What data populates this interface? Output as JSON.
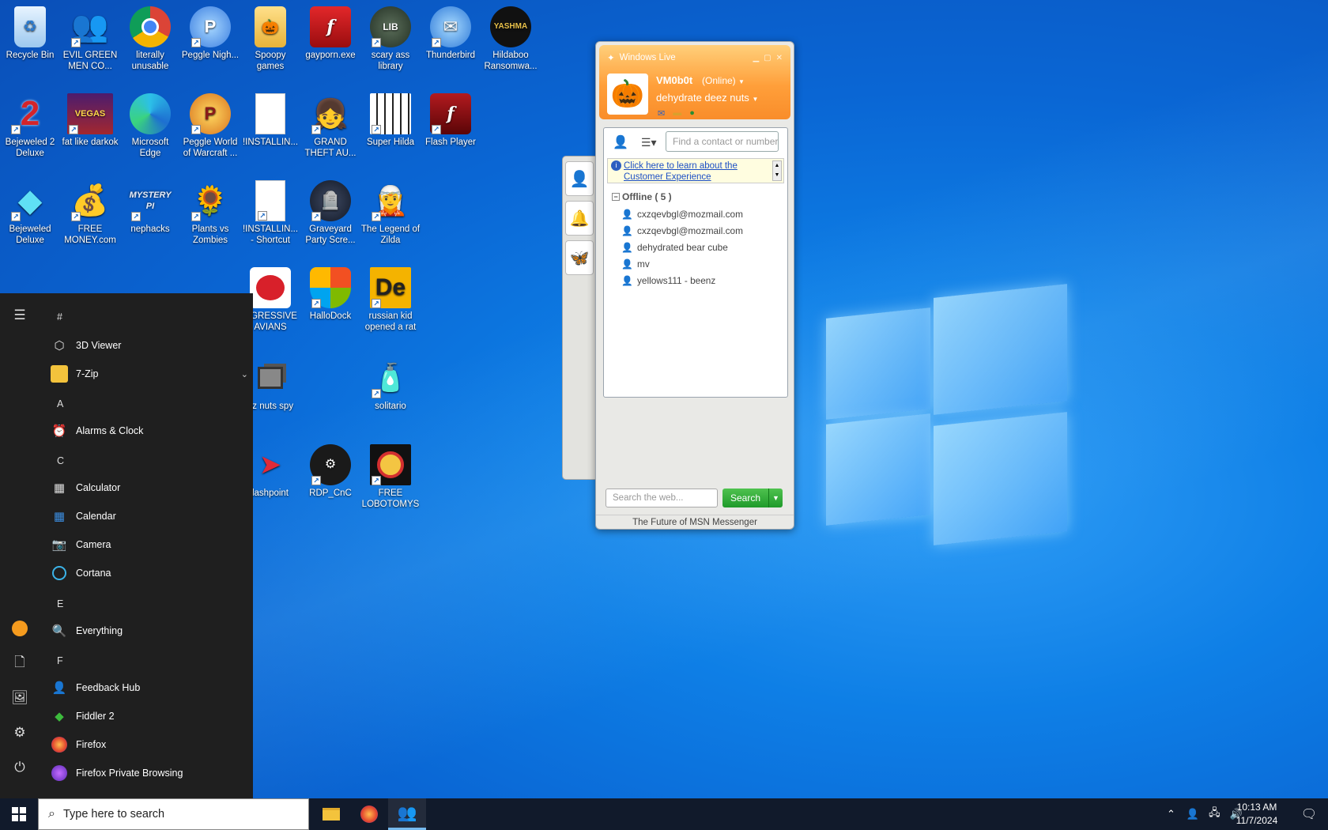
{
  "desktop": {
    "icons": [
      {
        "label": "Recycle Bin"
      },
      {
        "label": "EVIL GREEN MEN CO..."
      },
      {
        "label": "literally unusable"
      },
      {
        "label": "Peggle Nigh..."
      },
      {
        "label": "Spoopy games"
      },
      {
        "label": "gayporn.exe"
      },
      {
        "label": "scary ass library"
      },
      {
        "label": "Thunderbird"
      },
      {
        "label": "Hildaboo Ransomwa..."
      },
      {
        "label": "Bejeweled 2 Deluxe"
      },
      {
        "label": "fat like darkok"
      },
      {
        "label": "Microsoft Edge"
      },
      {
        "label": "Peggle World of Warcraft ..."
      },
      {
        "label": "!INSTALLIN..."
      },
      {
        "label": "GRAND THEFT AU..."
      },
      {
        "label": "Super Hilda"
      },
      {
        "label": "Flash Player"
      },
      {
        "label": "Bejeweled Deluxe"
      },
      {
        "label": "FREE MONEY.com"
      },
      {
        "label": "nephacks"
      },
      {
        "label": "Plants vs Zombies"
      },
      {
        "label": "!INSTALLIN... - Shortcut"
      },
      {
        "label": "Graveyard Party Scre..."
      },
      {
        "label": "The Legend of Zilda"
      },
      {
        "label": "GGRESSIVE AVIANS"
      },
      {
        "label": "HalloDock"
      },
      {
        "label": "russian kid opened a rat"
      },
      {
        "label": "ez nuts spy"
      },
      {
        "label": "solitario"
      },
      {
        "label": "lashpoint"
      },
      {
        "label": "RDP_CnC"
      },
      {
        "label": "FREE LOBOTOMYS"
      }
    ],
    "logo_texts": {
      "yashma": "YASHMA",
      "mystery": "MYSTERY PI",
      "vegas": "VEGAS",
      "de": "De"
    }
  },
  "start_menu": {
    "headers": {
      "hash": "#",
      "a": "A",
      "c": "C",
      "e": "E",
      "f": "F"
    },
    "apps": {
      "viewer3d": "3D Viewer",
      "zip7": "7-Zip",
      "alarms": "Alarms & Clock",
      "calculator": "Calculator",
      "calendar": "Calendar",
      "camera": "Camera",
      "cortana": "Cortana",
      "everything": "Everything",
      "feedback": "Feedback Hub",
      "fiddler": "Fiddler 2",
      "firefox": "Firefox",
      "firefox_private": "Firefox Private Browsing"
    }
  },
  "taskbar": {
    "search_placeholder": "Type here to search",
    "time": "10:13 AM",
    "date": "11/7/2024"
  },
  "wlm": {
    "title": "Windows Live",
    "username": "VM0b0t",
    "status": "(Online)",
    "personal_message": "dehydrate deez nuts",
    "find_placeholder": "Find a contact or number",
    "notice_link": "Click here to learn about the Customer Experience",
    "group_label": "Offline ( 5 )",
    "contacts": [
      "cxzqevbgl@mozmail.com",
      "cxzqevbgl@mozmail.com",
      "dehydrated bear cube",
      "mv",
      "yellows111 - beenz"
    ],
    "web_search_placeholder": "Search the web...",
    "search_button": "Search",
    "footer": "The Future of MSN Messenger"
  },
  "colors": {
    "accent": "#0a66d4",
    "wlm_orange": "#ff9f3a",
    "search_green": "#1f9a2a"
  }
}
